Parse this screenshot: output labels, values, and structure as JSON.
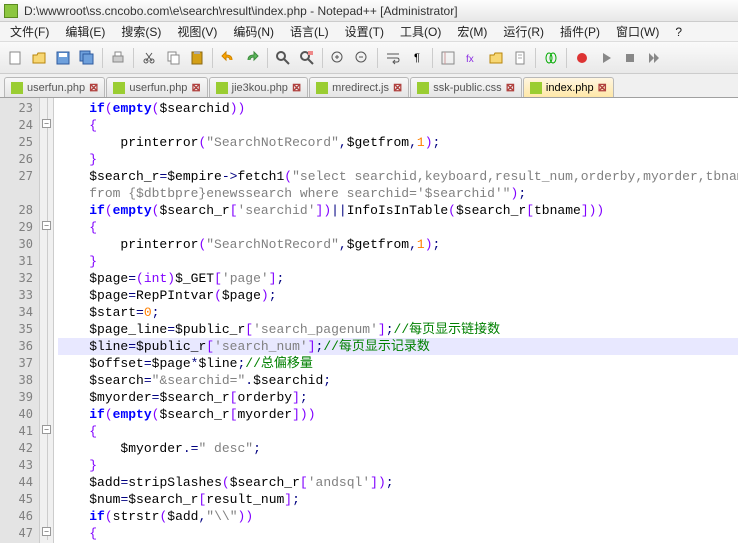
{
  "window": {
    "title": "D:\\wwwroot\\ss.cncobo.com\\e\\search\\result\\index.php - Notepad++ [Administrator]"
  },
  "menu": {
    "items": [
      "文件(F)",
      "编辑(E)",
      "搜索(S)",
      "视图(V)",
      "编码(N)",
      "语言(L)",
      "设置(T)",
      "工具(O)",
      "宏(M)",
      "运行(R)",
      "插件(P)",
      "窗口(W)",
      "?"
    ]
  },
  "tabs": [
    {
      "label": "userfun.php",
      "active": false
    },
    {
      "label": "userfun.php",
      "active": false
    },
    {
      "label": "jie3kou.php",
      "active": false
    },
    {
      "label": "mredirect.js",
      "active": false
    },
    {
      "label": "ssk-public.css",
      "active": false
    },
    {
      "label": "index.php",
      "active": true
    }
  ],
  "editor": {
    "first_line": 23,
    "highlighted_line": 36,
    "lines": [
      {
        "n": 23,
        "tokens": [
          [
            "",
            "    "
          ],
          [
            "kw",
            "if"
          ],
          [
            "paren",
            "("
          ],
          [
            "kw",
            "empty"
          ],
          [
            "paren",
            "("
          ],
          [
            "var",
            "$searchid"
          ],
          [
            "paren",
            "))"
          ]
        ]
      },
      {
        "n": 24,
        "fold": "box",
        "tokens": [
          [
            "",
            "    "
          ],
          [
            "brace",
            "{"
          ]
        ]
      },
      {
        "n": 25,
        "tokens": [
          [
            "",
            "        "
          ],
          [
            "fn",
            "printerror"
          ],
          [
            "paren",
            "("
          ],
          [
            "str",
            "\"SearchNotRecord\""
          ],
          [
            "op",
            ","
          ],
          [
            "var",
            "$getfrom"
          ],
          [
            "op",
            ","
          ],
          [
            "num",
            "1"
          ],
          [
            "paren",
            ")"
          ],
          [
            "op",
            ";"
          ]
        ]
      },
      {
        "n": 26,
        "tokens": [
          [
            "",
            "    "
          ],
          [
            "brace",
            "}"
          ]
        ]
      },
      {
        "n": 27,
        "tokens": [
          [
            "",
            "    "
          ],
          [
            "var",
            "$search_r"
          ],
          [
            "op",
            "="
          ],
          [
            "var",
            "$empire"
          ],
          [
            "op",
            "->"
          ],
          [
            "fn",
            "fetch1"
          ],
          [
            "paren",
            "("
          ],
          [
            "str",
            "\"select searchid,keyboard,result_num,orderby,myorder,tbname,"
          ]
        ]
      },
      {
        "n": 0,
        "tokens": [
          [
            "",
            "    "
          ],
          [
            "str",
            "from {$dbtbpre}enewssearch where searchid='$searchid'\""
          ],
          [
            "paren",
            ")"
          ],
          [
            "op",
            ";"
          ]
        ]
      },
      {
        "n": 28,
        "tokens": [
          [
            "",
            "    "
          ],
          [
            "kw",
            "if"
          ],
          [
            "paren",
            "("
          ],
          [
            "kw",
            "empty"
          ],
          [
            "paren",
            "("
          ],
          [
            "var",
            "$search_r"
          ],
          [
            "paren",
            "["
          ],
          [
            "str",
            "'searchid'"
          ],
          [
            "paren",
            "])"
          ],
          [
            "op",
            "||"
          ],
          [
            "fn",
            "InfoIsInTable"
          ],
          [
            "paren",
            "("
          ],
          [
            "var",
            "$search_r"
          ],
          [
            "paren",
            "["
          ],
          [
            "var",
            "tbname"
          ],
          [
            "paren",
            "]))"
          ]
        ]
      },
      {
        "n": 29,
        "fold": "box",
        "tokens": [
          [
            "",
            "    "
          ],
          [
            "brace",
            "{"
          ]
        ]
      },
      {
        "n": 30,
        "tokens": [
          [
            "",
            "        "
          ],
          [
            "fn",
            "printerror"
          ],
          [
            "paren",
            "("
          ],
          [
            "str",
            "\"SearchNotRecord\""
          ],
          [
            "op",
            ","
          ],
          [
            "var",
            "$getfrom"
          ],
          [
            "op",
            ","
          ],
          [
            "num",
            "1"
          ],
          [
            "paren",
            ")"
          ],
          [
            "op",
            ";"
          ]
        ]
      },
      {
        "n": 31,
        "tokens": [
          [
            "",
            "    "
          ],
          [
            "brace",
            "}"
          ]
        ]
      },
      {
        "n": 32,
        "tokens": [
          [
            "",
            "    "
          ],
          [
            "var",
            "$page"
          ],
          [
            "op",
            "="
          ],
          [
            "paren",
            "("
          ],
          [
            "kw2",
            "int"
          ],
          [
            "paren",
            ")"
          ],
          [
            "var",
            "$_GET"
          ],
          [
            "paren",
            "["
          ],
          [
            "str",
            "'page'"
          ],
          [
            "paren",
            "]"
          ],
          [
            "op",
            ";"
          ]
        ]
      },
      {
        "n": 33,
        "tokens": [
          [
            "",
            "    "
          ],
          [
            "var",
            "$page"
          ],
          [
            "op",
            "="
          ],
          [
            "fn",
            "RepPIntvar"
          ],
          [
            "paren",
            "("
          ],
          [
            "var",
            "$page"
          ],
          [
            "paren",
            ")"
          ],
          [
            "op",
            ";"
          ]
        ]
      },
      {
        "n": 34,
        "tokens": [
          [
            "",
            "    "
          ],
          [
            "var",
            "$start"
          ],
          [
            "op",
            "="
          ],
          [
            "num",
            "0"
          ],
          [
            "op",
            ";"
          ]
        ]
      },
      {
        "n": 35,
        "tokens": [
          [
            "",
            "    "
          ],
          [
            "var",
            "$page_line"
          ],
          [
            "op",
            "="
          ],
          [
            "var",
            "$public_r"
          ],
          [
            "paren",
            "["
          ],
          [
            "str",
            "'search_pagenum'"
          ],
          [
            "paren",
            "]"
          ],
          [
            "op",
            ";"
          ],
          [
            "cmt",
            "//每页显示链接数"
          ]
        ]
      },
      {
        "n": 36,
        "hl": true,
        "tokens": [
          [
            "",
            "    "
          ],
          [
            "var",
            "$line"
          ],
          [
            "op",
            "="
          ],
          [
            "var",
            "$public_r"
          ],
          [
            "paren",
            "["
          ],
          [
            "str",
            "'search_num'"
          ],
          [
            "paren",
            "]"
          ],
          [
            "op",
            ";"
          ],
          [
            "cmt",
            "//每页显示记录数"
          ]
        ]
      },
      {
        "n": 37,
        "tokens": [
          [
            "",
            "    "
          ],
          [
            "var",
            "$offset"
          ],
          [
            "op",
            "="
          ],
          [
            "var",
            "$page"
          ],
          [
            "op",
            "*"
          ],
          [
            "var",
            "$line"
          ],
          [
            "op",
            ";"
          ],
          [
            "cmt",
            "//总偏移量"
          ]
        ]
      },
      {
        "n": 38,
        "tokens": [
          [
            "",
            "    "
          ],
          [
            "var",
            "$search"
          ],
          [
            "op",
            "="
          ],
          [
            "str",
            "\"&searchid=\""
          ],
          [
            "op",
            "."
          ],
          [
            "var",
            "$searchid"
          ],
          [
            "op",
            ";"
          ]
        ]
      },
      {
        "n": 39,
        "tokens": [
          [
            "",
            "    "
          ],
          [
            "var",
            "$myorder"
          ],
          [
            "op",
            "="
          ],
          [
            "var",
            "$search_r"
          ],
          [
            "paren",
            "["
          ],
          [
            "var",
            "orderby"
          ],
          [
            "paren",
            "]"
          ],
          [
            "op",
            ";"
          ]
        ]
      },
      {
        "n": 40,
        "tokens": [
          [
            "",
            "    "
          ],
          [
            "kw",
            "if"
          ],
          [
            "paren",
            "("
          ],
          [
            "kw",
            "empty"
          ],
          [
            "paren",
            "("
          ],
          [
            "var",
            "$search_r"
          ],
          [
            "paren",
            "["
          ],
          [
            "var",
            "myorder"
          ],
          [
            "paren",
            "]))"
          ]
        ]
      },
      {
        "n": 41,
        "fold": "box",
        "tokens": [
          [
            "",
            "    "
          ],
          [
            "brace",
            "{"
          ]
        ]
      },
      {
        "n": 42,
        "tokens": [
          [
            "",
            "        "
          ],
          [
            "var",
            "$myorder"
          ],
          [
            "op",
            ".="
          ],
          [
            "str",
            "\" desc\""
          ],
          [
            "op",
            ";"
          ]
        ]
      },
      {
        "n": 43,
        "tokens": [
          [
            "",
            "    "
          ],
          [
            "brace",
            "}"
          ]
        ]
      },
      {
        "n": 44,
        "tokens": [
          [
            "",
            "    "
          ],
          [
            "var",
            "$add"
          ],
          [
            "op",
            "="
          ],
          [
            "fn",
            "stripSlashes"
          ],
          [
            "paren",
            "("
          ],
          [
            "var",
            "$search_r"
          ],
          [
            "paren",
            "["
          ],
          [
            "str",
            "'andsql'"
          ],
          [
            "paren",
            "])"
          ],
          [
            "op",
            ";"
          ]
        ]
      },
      {
        "n": 45,
        "tokens": [
          [
            "",
            "    "
          ],
          [
            "var",
            "$num"
          ],
          [
            "op",
            "="
          ],
          [
            "var",
            "$search_r"
          ],
          [
            "paren",
            "["
          ],
          [
            "var",
            "result_num"
          ],
          [
            "paren",
            "]"
          ],
          [
            "op",
            ";"
          ]
        ]
      },
      {
        "n": 46,
        "tokens": [
          [
            "",
            "    "
          ],
          [
            "kw",
            "if"
          ],
          [
            "paren",
            "("
          ],
          [
            "fn",
            "strstr"
          ],
          [
            "paren",
            "("
          ],
          [
            "var",
            "$add"
          ],
          [
            "op",
            ","
          ],
          [
            "str",
            "\"\\\\\""
          ],
          [
            "paren",
            "))"
          ]
        ]
      },
      {
        "n": 47,
        "fold": "box",
        "tokens": [
          [
            "",
            "    "
          ],
          [
            "brace",
            "{"
          ]
        ]
      }
    ]
  }
}
